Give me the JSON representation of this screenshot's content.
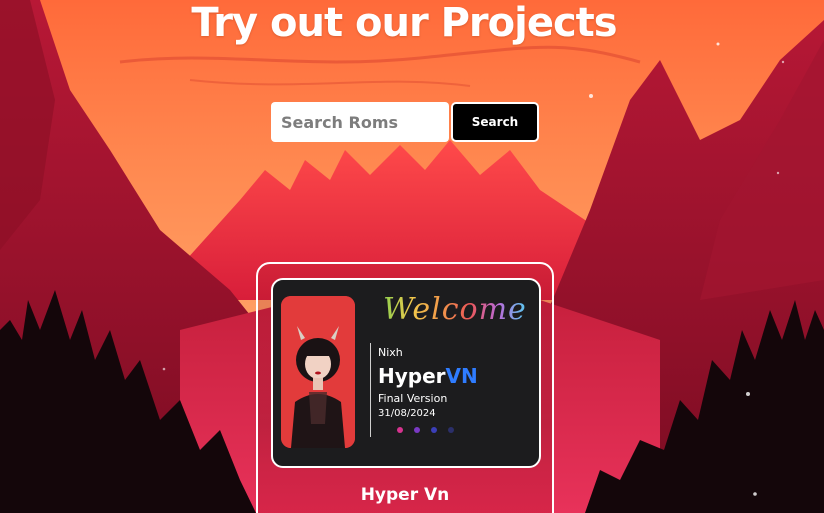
{
  "page": {
    "title": "Try out our Projects"
  },
  "search": {
    "placeholder": "Search Roms",
    "value": "",
    "button_label": "Search"
  },
  "projects": [
    {
      "title": "Hyper Vn",
      "preview": {
        "welcome_text": "Welcome",
        "author": "Nixh",
        "rom_name_part1": "Hyper",
        "rom_name_part2": "VN",
        "version": "Final Version",
        "date": "31/08/2024",
        "dot_colors": [
          "#d6338f",
          "#7a39c4",
          "#3b3fb8",
          "#2b2f6a"
        ]
      }
    }
  ],
  "colors": {
    "sky_top": "#ff7a45",
    "sky_mid": "#ffa36a",
    "mountain": "#e52a45",
    "search_button_bg": "#000000",
    "accent_blue": "#2f7cff"
  }
}
